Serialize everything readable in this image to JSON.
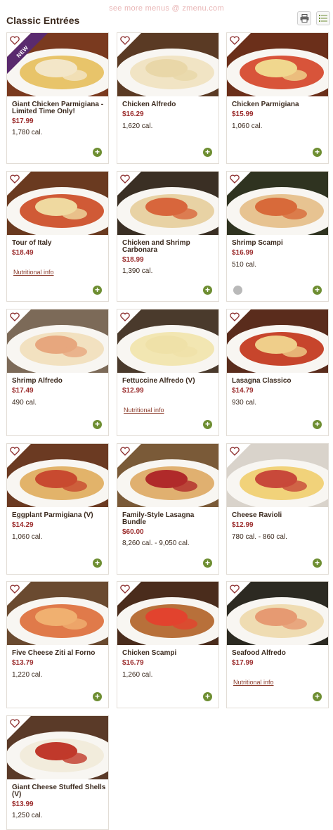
{
  "watermark": "see more menus @ zmenu.com",
  "page_title": "Classic Entrées",
  "colors": {
    "price": "#9b2c2c",
    "add": "#6e8e32",
    "new_badge": "#5a2a6e"
  },
  "items": [
    {
      "name": "Giant Chicken Parmigiana - Limited Time Only!",
      "price": "$17.99",
      "cal": "1,780 cal.",
      "badge": "NEW"
    },
    {
      "name": "Chicken Alfredo",
      "price": "$16.29",
      "cal": "1,620 cal."
    },
    {
      "name": "Chicken Parmigiana",
      "price": "$15.99",
      "cal": "1,060 cal."
    },
    {
      "name": "Tour of Italy",
      "price": "$18.49",
      "nutri": "Nutritional info"
    },
    {
      "name": "Chicken and Shrimp Carbonara",
      "price": "$18.99",
      "cal": "1,390 cal."
    },
    {
      "name": "Shrimp Scampi",
      "price": "$16.99",
      "cal": "510 cal."
    },
    {
      "name": "Shrimp Alfredo",
      "price": "$17.49",
      "cal": "490 cal."
    },
    {
      "name": "Fettuccine Alfredo (V)",
      "price": "$12.99",
      "nutri": "Nutritional info"
    },
    {
      "name": "Lasagna Classico",
      "price": "$14.79",
      "cal": "930 cal."
    },
    {
      "name": "Eggplant Parmigiana (V)",
      "price": "$14.29",
      "cal": "1,060 cal."
    },
    {
      "name": "Family-Style Lasagna Bundle",
      "price": "$60.00",
      "cal": "8,260 cal. - 9,050 cal."
    },
    {
      "name": "Cheese Ravioli",
      "price": "$12.99",
      "cal": "780 cal. - 860 cal."
    },
    {
      "name": "Five Cheese Ziti al Forno",
      "price": "$13.79",
      "cal": "1,220 cal."
    },
    {
      "name": "Chicken Scampi",
      "price": "$16.79",
      "cal": "1,260 cal."
    },
    {
      "name": "Seafood Alfredo",
      "price": "$17.99",
      "nutri": "Nutritional info"
    },
    {
      "name": "Giant Cheese Stuffed Shells (V)",
      "price": "$13.99",
      "cal": "1,250 cal."
    }
  ],
  "add_symbol": "+"
}
